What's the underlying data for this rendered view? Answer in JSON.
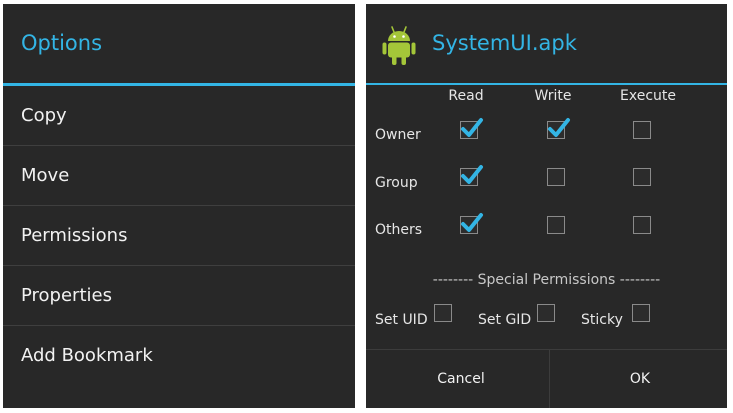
{
  "options_dialog": {
    "title": "Options",
    "items": [
      {
        "label": "Copy"
      },
      {
        "label": "Move"
      },
      {
        "label": "Permissions"
      },
      {
        "label": "Properties"
      },
      {
        "label": "Add Bookmark"
      }
    ]
  },
  "permissions_dialog": {
    "title": "SystemUI.apk",
    "icon": "android-icon",
    "columns": [
      "Read",
      "Write",
      "Execute"
    ],
    "rows": [
      {
        "label": "Owner",
        "read": true,
        "write": true,
        "execute": false
      },
      {
        "label": "Group",
        "read": true,
        "write": false,
        "execute": false
      },
      {
        "label": "Others",
        "read": true,
        "write": false,
        "execute": false
      }
    ],
    "special_title": "-------- Special Permissions --------",
    "special": [
      {
        "label": "Set UID",
        "checked": false
      },
      {
        "label": "Set GID",
        "checked": false
      },
      {
        "label": "Sticky",
        "checked": false
      }
    ],
    "cancel_label": "Cancel",
    "ok_label": "OK"
  },
  "colors": {
    "accent": "#33b5e5",
    "background": "#282828",
    "text": "#f2f2f2"
  }
}
